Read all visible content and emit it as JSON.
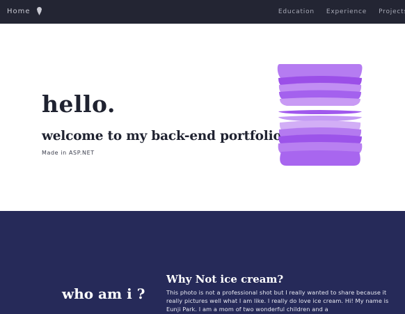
{
  "nav": {
    "brand_label": "Home",
    "brand_icon": "ice-cream-icon",
    "links": [
      "Education",
      "Experience",
      "Projects"
    ]
  },
  "hero": {
    "title": "hello.",
    "subtitle": "welcome to my back-end portfolio site.",
    "made_in": "Made in ASP.NET",
    "image_icon": "stacked-ice-cream-graphic"
  },
  "about": {
    "heading": "who am i ?",
    "subheading": "Why Not ice cream?",
    "text": "This photo is not a professional shot but I really wanted to share because it really pictures well what I am like. I really do love ice cream. Hi! My name is Eunji Park. I am a mom of two wonderful children and a"
  },
  "colors": {
    "navbar": "#232533",
    "about_bg": "#262a59",
    "accent": "#a855f7",
    "title_text": "#1f2230"
  }
}
